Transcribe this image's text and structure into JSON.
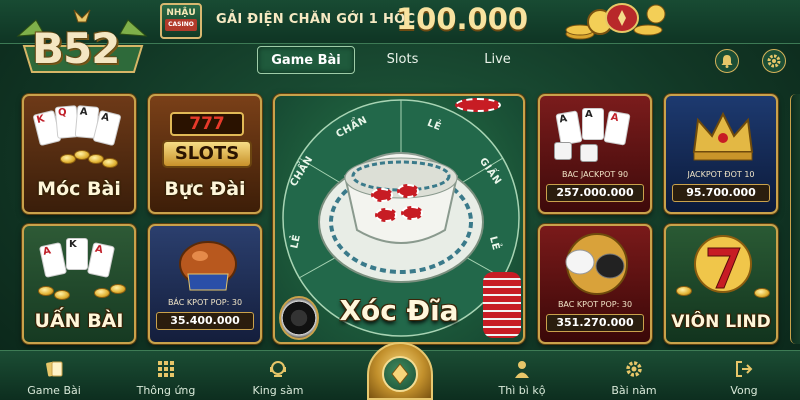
{
  "header": {
    "logo_text": "B52",
    "badge_top": "NHẬU",
    "badge_sub": "CASINO",
    "promo_text": "GẢI ĐIỆN CHĂN GỚI 1 HỐC",
    "promo_amount": "100.000"
  },
  "tabs": [
    {
      "label": "Game Bài",
      "active": true
    },
    {
      "label": "Slots",
      "active": false
    },
    {
      "label": "Live",
      "active": false
    }
  ],
  "header_icons": [
    "bell-icon",
    "gear-icon"
  ],
  "games": {
    "moc_bai": {
      "title": "Móc Bài"
    },
    "buc_dai": {
      "title": "Bực Đài",
      "sign_777": "777",
      "sign_slots": "SLOTS"
    },
    "xoc_dia": {
      "title": "Xóc Đĩa",
      "segments": [
        "CHẨN",
        "LẺ",
        "GIẤN",
        "LẺ",
        "CHẨN",
        "LẺ"
      ]
    },
    "bac_jackpot_90": {
      "label": "BAC JACKPOT 90",
      "amount": "257.000.000"
    },
    "jackpot_bot_10": {
      "label": "JACKPOT ĐOT 10",
      "amount": "95.700.000"
    },
    "uan_bai": {
      "title": "UẤN BÀI"
    },
    "bac_kpot_pop_30_a": {
      "label": "BÁC KPOT POP: 30",
      "amount": "35.400.000"
    },
    "bac_kpot_pop_30_b": {
      "label": "BAC KPOT POP: 30",
      "amount": "351.270.000"
    },
    "vion_lind": {
      "title": "VIÔN LIND"
    }
  },
  "cards": {
    "moc_bai": [
      "K",
      "Q",
      "A",
      "A"
    ],
    "uan_bai": [
      "A",
      "K",
      "A"
    ],
    "bac_jackpot": [
      "A",
      "A",
      "A"
    ]
  },
  "bottom_nav": [
    {
      "label": "Game Bài",
      "icon": "cards-icon"
    },
    {
      "label": "Thông ứng",
      "icon": "grid-icon"
    },
    {
      "label": "King sàm",
      "icon": "support-icon"
    },
    {
      "label": "Thì bì kộ",
      "icon": "person-icon"
    },
    {
      "label": "Bài nàm",
      "icon": "gear-icon"
    },
    {
      "label": "Vong",
      "icon": "exit-icon"
    }
  ],
  "colors": {
    "accent_gold": "#c9a24b",
    "bg_green": "#1f5a3c",
    "jackpot_box": "#2a1d0e"
  }
}
